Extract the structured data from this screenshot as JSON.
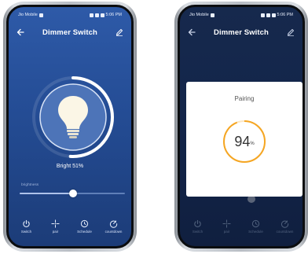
{
  "left_phone": {
    "status_carrier": "Jio Mobile",
    "status_time": "5:06 PM",
    "title": "Dimmer Switch",
    "brightness_label": "Bright 51%",
    "brightness_value": 51,
    "slider_label": "brightness",
    "slider_fraction": 0.51,
    "tabs": [
      {
        "label": "Switch",
        "icon": "power-icon"
      },
      {
        "label": "pair",
        "icon": "pair-icon"
      },
      {
        "label": "Schedule",
        "icon": "clock-icon"
      },
      {
        "label": "countdown",
        "icon": "timer-icon"
      }
    ]
  },
  "right_phone": {
    "status_carrier": "Jio Mobile",
    "status_time": "5:06 PM",
    "title": "Dimmer Switch",
    "pairing_title": "Pairing",
    "pairing_value": "94",
    "pairing_unit": "%",
    "pairing_fraction": 0.94,
    "tabs": [
      {
        "label": "Switch",
        "icon": "power-icon"
      },
      {
        "label": "pair",
        "icon": "pair-icon"
      },
      {
        "label": "Schedule",
        "icon": "clock-icon"
      },
      {
        "label": "countdown",
        "icon": "timer-icon"
      }
    ]
  },
  "colors": {
    "accent_ring": "#f5a623",
    "dial_fill": "#4d74b8",
    "screen_blue": "#2a529c"
  }
}
